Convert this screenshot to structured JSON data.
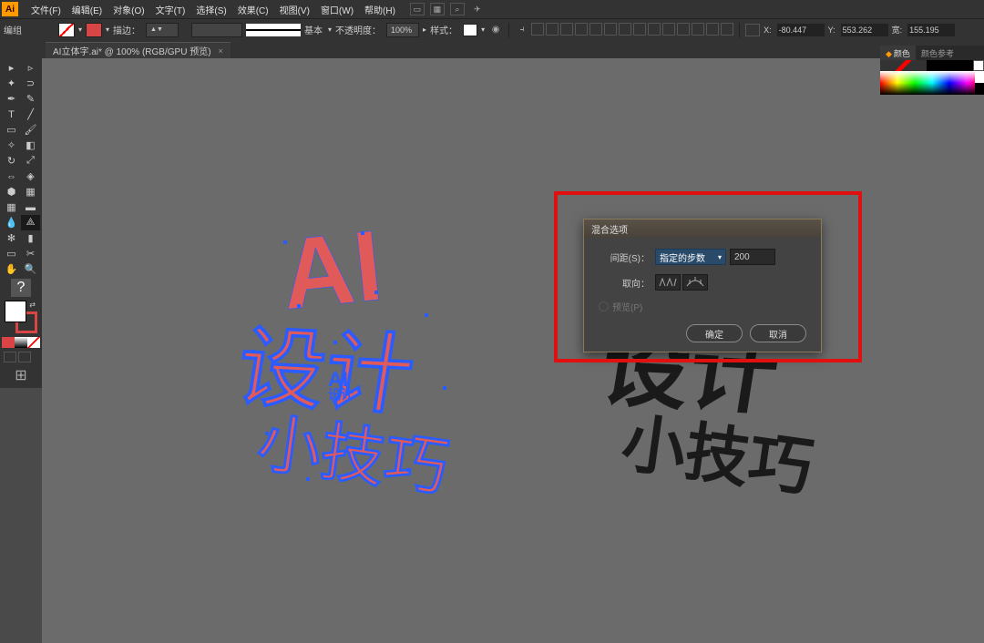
{
  "app": {
    "icon_text": "Ai"
  },
  "menubar": {
    "items": [
      "文件(F)",
      "编辑(E)",
      "对象(O)",
      "文字(T)",
      "选择(S)",
      "效果(C)",
      "视图(V)",
      "窗口(W)",
      "帮助(H)"
    ]
  },
  "controlbar": {
    "mode_label": "编组",
    "stroke_label": "描边：",
    "stroke_value": "",
    "brush_label": "基本",
    "opacity_label": "不透明度：",
    "opacity_value": "100%",
    "style_label": "样式：",
    "coord_x_label": "X:",
    "coord_x_value": "-80.447",
    "coord_y_label": "Y:",
    "coord_y_value": "553.262",
    "coord_w_label": "宽:",
    "coord_w_value": "155.195"
  },
  "tab": {
    "title": "AI立体字.ai* @ 100% (RGB/GPU 预览)",
    "close": "×"
  },
  "dialog": {
    "title": "混合选项",
    "spacing_label": "间距(S)：",
    "spacing_select": "指定的步数",
    "spacing_value": "200",
    "orient_label": "取向：",
    "preview_label": "预览(P)",
    "ok": "确定",
    "cancel": "取消"
  },
  "right_panel": {
    "tab1": "颜色",
    "tab2": "颜色参考"
  },
  "artwork": {
    "line1": "AI",
    "line2": "设计",
    "line3": "小技巧"
  }
}
